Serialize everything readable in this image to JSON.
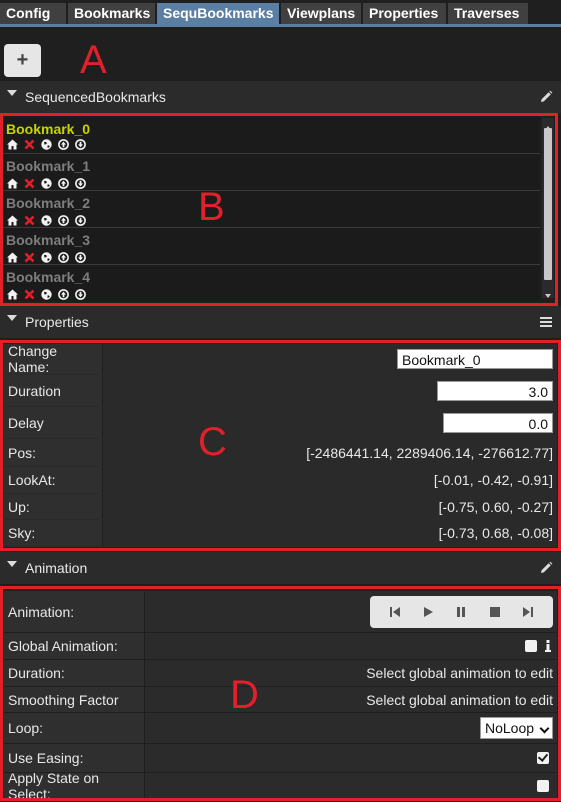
{
  "tabs": [
    {
      "label": "Config",
      "active": false
    },
    {
      "label": "Bookmarks",
      "active": false
    },
    {
      "label": "SequBookmarks",
      "active": true
    },
    {
      "label": "Viewplans",
      "active": false
    },
    {
      "label": "Properties",
      "active": false
    },
    {
      "label": "Traverses",
      "active": false
    }
  ],
  "toolbar": {
    "add_label": "+"
  },
  "annotations": {
    "a": "A",
    "b": "B",
    "c": "C",
    "d": "D"
  },
  "sections": {
    "sequenced": {
      "title": "SequencedBookmarks",
      "icon": "pencil-icon"
    },
    "properties": {
      "title": "Properties",
      "icon": "menu-icon"
    },
    "animation": {
      "title": "Animation",
      "icon": "pencil-icon"
    }
  },
  "bookmarks": [
    {
      "name": "Bookmark_0",
      "active": true
    },
    {
      "name": "Bookmark_1",
      "active": false
    },
    {
      "name": "Bookmark_2",
      "active": false
    },
    {
      "name": "Bookmark_3",
      "active": false
    },
    {
      "name": "Bookmark_4",
      "active": false
    }
  ],
  "bookmark_icons": [
    "home-icon",
    "delete-icon",
    "globe-icon",
    "move-up-icon",
    "move-down-icon"
  ],
  "properties": {
    "change_name": {
      "label": "Change Name:",
      "value": "Bookmark_0"
    },
    "duration": {
      "label": "Duration",
      "value": "3.0"
    },
    "delay": {
      "label": "Delay",
      "value": "0.0"
    },
    "pos": {
      "label": "Pos:",
      "value": "[-2486441.14, 2289406.14, -276612.77]"
    },
    "lookat": {
      "label": "LookAt:",
      "value": "[-0.01, -0.42, -0.91]"
    },
    "up": {
      "label": "Up:",
      "value": "[-0.75, 0.60, -0.27]"
    },
    "sky": {
      "label": "Sky:",
      "value": "[-0.73, 0.68, -0.08]"
    }
  },
  "animation": {
    "animation": {
      "label": "Animation:"
    },
    "player_icons": [
      "skip-back-icon",
      "play-icon",
      "pause-icon",
      "stop-icon",
      "skip-forward-icon"
    ],
    "global_animation": {
      "label": "Global Animation:",
      "checked": false
    },
    "duration": {
      "label": "Duration:",
      "value": "Select global animation to edit"
    },
    "smoothing": {
      "label": "Smoothing Factor",
      "value": "Select global animation to edit"
    },
    "loop": {
      "label": "Loop:",
      "value": "NoLoop"
    },
    "use_easing": {
      "label": "Use Easing:",
      "checked": true
    },
    "apply_state": {
      "label": "Apply State on Select:",
      "checked": false
    }
  }
}
